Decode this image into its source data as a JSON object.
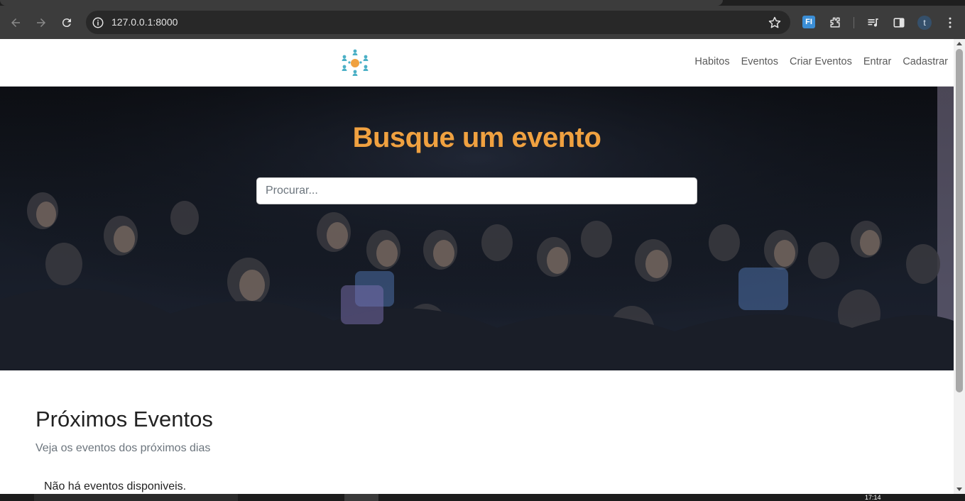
{
  "browser": {
    "url": "127.0.0.1:8000",
    "profile_initial": "t",
    "extension_label": "FI"
  },
  "nav": {
    "items": [
      "Habitos",
      "Eventos",
      "Criar Eventos",
      "Entrar",
      "Cadastrar"
    ]
  },
  "hero": {
    "title": "Busque um evento",
    "search_placeholder": "Procurar..."
  },
  "section": {
    "title": "Próximos Eventos",
    "subtitle": "Veja os eventos dos próximos dias",
    "empty_message": "Não há eventos disponiveis."
  },
  "taskbar": {
    "clock": "17:14"
  },
  "colors": {
    "accent": "#f0a140",
    "logo_teal": "#4bb0c6",
    "logo_orange": "#f0a140"
  }
}
